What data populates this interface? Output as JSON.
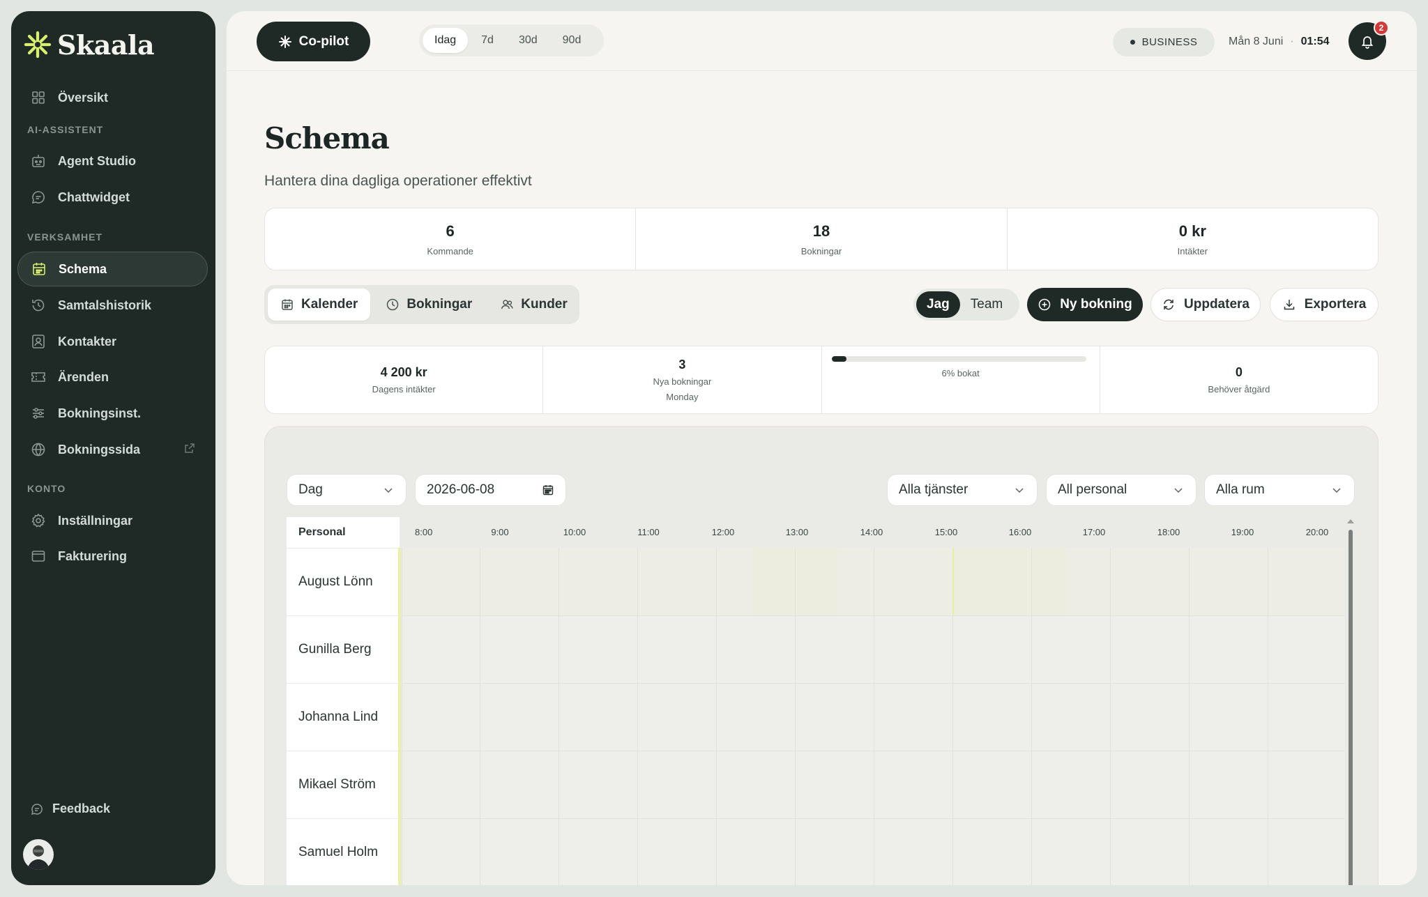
{
  "sidebar": {
    "brand": "Skaala",
    "items": [
      {
        "label": "Översikt"
      },
      {
        "label": "Agent Studio"
      },
      {
        "label": "Chattwidget"
      },
      {
        "label": "Schema"
      },
      {
        "label": "Samtalshistorik"
      },
      {
        "label": "Kontakter"
      },
      {
        "label": "Ärenden"
      },
      {
        "label": "Bokningsinst."
      },
      {
        "label": "Bokningssida"
      },
      {
        "label": "Inställningar"
      },
      {
        "label": "Fakturering"
      }
    ],
    "sections": {
      "ai": "AI-ASSISTENT",
      "business": "VERKSAMHET",
      "account": "KONTO"
    },
    "feedback": "Feedback",
    "active_item": "Schema",
    "accent_color": "#d9ef6d"
  },
  "topbar": {
    "copilot": "Co-pilot",
    "ranges": [
      "Idag",
      "7d",
      "30d",
      "90d"
    ],
    "active_range": "Idag",
    "plan": "BUSINESS",
    "date": "Mån 8 Juni",
    "time": "01:54",
    "notifications": "2"
  },
  "page": {
    "title": "Schema",
    "subtitle": "Hantera dina dagliga operationer effektivt"
  },
  "summary": [
    {
      "value": "6",
      "label": "Kommande"
    },
    {
      "value": "18",
      "label": "Bokningar"
    },
    {
      "value": "0 kr",
      "label": "Intäkter"
    }
  ],
  "view_tabs": [
    "Kalender",
    "Bokningar",
    "Kunder"
  ],
  "scope": {
    "me": "Jag",
    "team": "Team"
  },
  "actions": {
    "new_booking": "Ny bokning",
    "refresh": "Uppdatera",
    "export": "Exportera"
  },
  "kpis": {
    "revenue": {
      "value": "4 200 kr",
      "label": "Dagens intäkter"
    },
    "new_bookings": {
      "value": "3",
      "label": "Nya bokningar",
      "sub": "Monday"
    },
    "booked": {
      "label": "6% bokat",
      "fraction": 0.06
    },
    "needs_action": {
      "value": "0",
      "label": "Behöver åtgärd"
    }
  },
  "calendar": {
    "view": "Dag",
    "date": "2026-06-08",
    "filters": {
      "services": "Alla tjänster",
      "staff": "All personal",
      "rooms": "Alla rum"
    },
    "personal_header": "Personal",
    "hours": [
      "8:00",
      "9:00",
      "10:00",
      "11:00",
      "12:00",
      "13:00",
      "14:00",
      "15:00",
      "16:00",
      "17:00",
      "18:00",
      "19:00",
      "20:00"
    ],
    "staff": [
      "August Lönn",
      "Gunilla Berg",
      "Johanna Lind",
      "Mikael Ström",
      "Samuel Holm"
    ]
  }
}
